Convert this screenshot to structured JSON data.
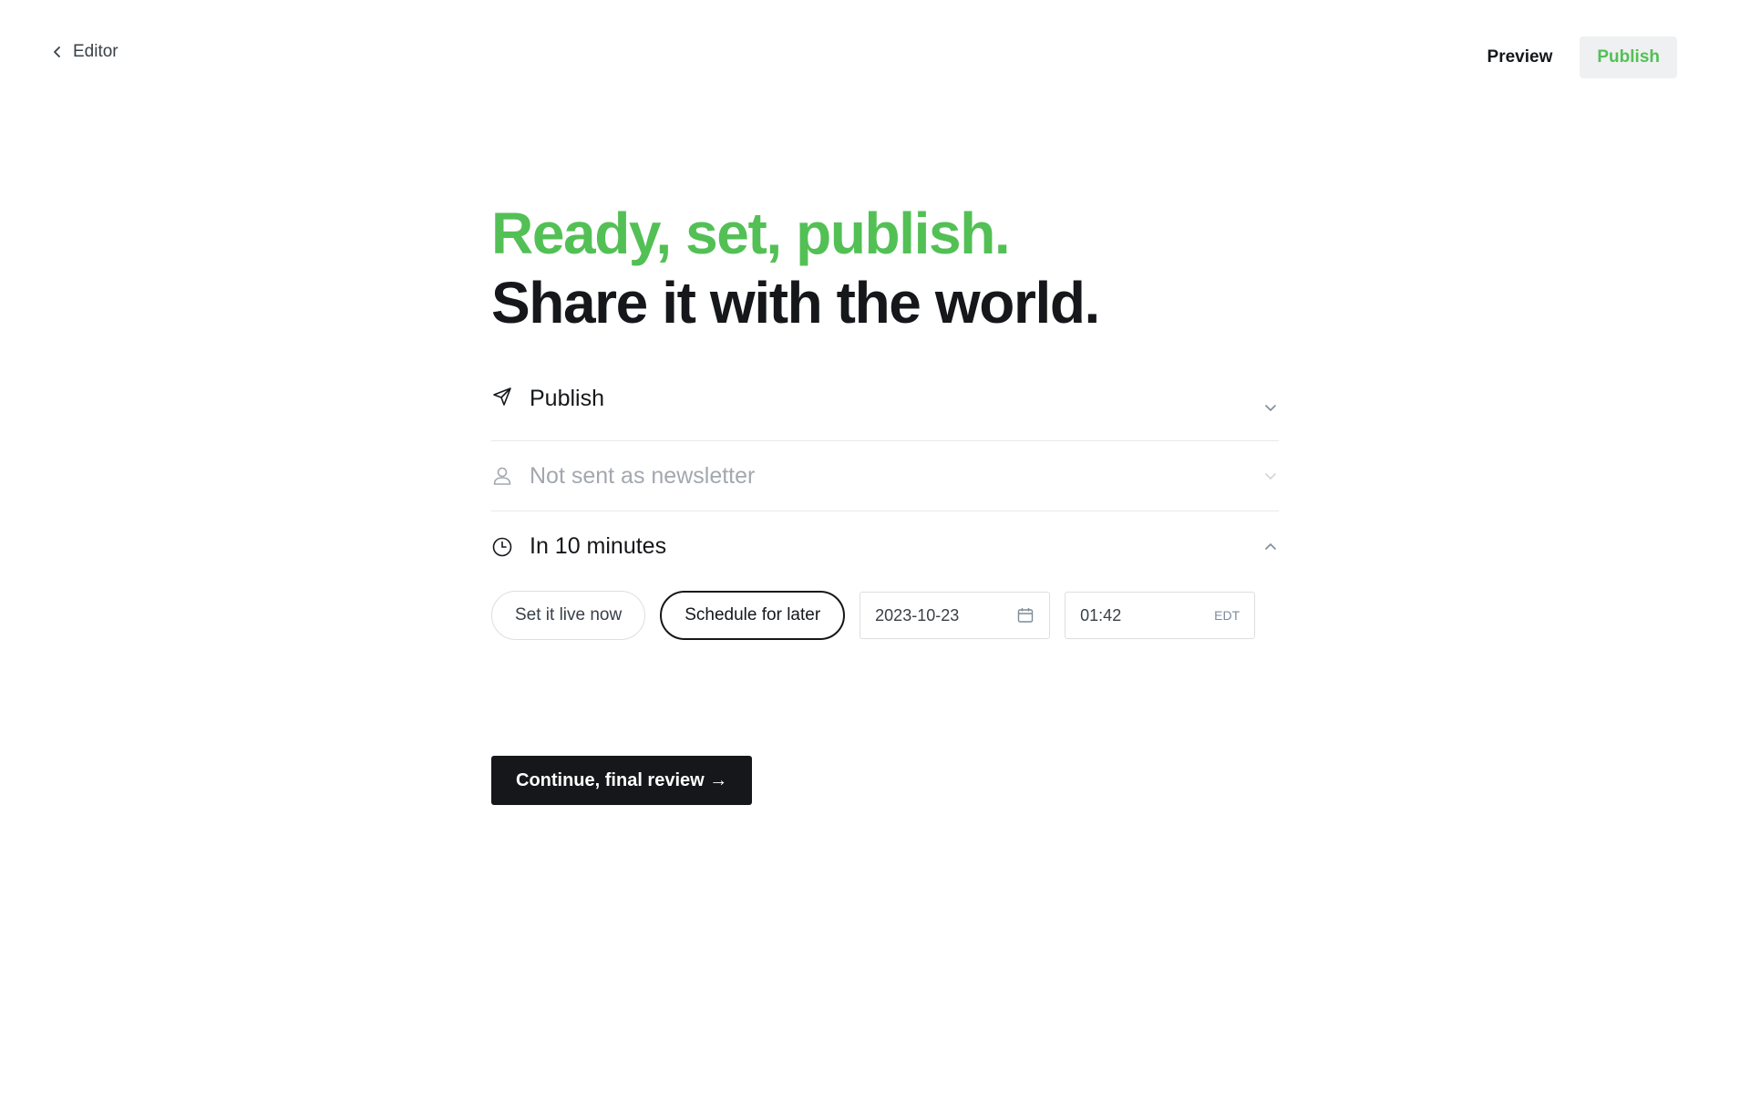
{
  "header": {
    "back_label": "Editor",
    "preview_label": "Preview",
    "publish_label": "Publish"
  },
  "headline": {
    "line1": "Ready, set, publish.",
    "line2": "Share it with the world."
  },
  "settings": [
    {
      "icon": "send-icon",
      "label": "Publish",
      "state": "collapsed"
    },
    {
      "icon": "user-icon",
      "label": "Not sent as newsletter",
      "state": "collapsed",
      "disabled": true
    },
    {
      "icon": "clock-icon",
      "label": "In 10 minutes",
      "state": "expanded"
    }
  ],
  "schedule": {
    "options": [
      "Set it live now",
      "Schedule for later"
    ],
    "selected": "Schedule for later",
    "date_value": "2023-10-23",
    "time_value": "01:42",
    "timezone": "EDT"
  },
  "continue_label": "Continue, final review →",
  "colors": {
    "accent": "#53c055",
    "text": "#15171a",
    "muted": "#a2a8ae",
    "border": "#dddee0"
  }
}
